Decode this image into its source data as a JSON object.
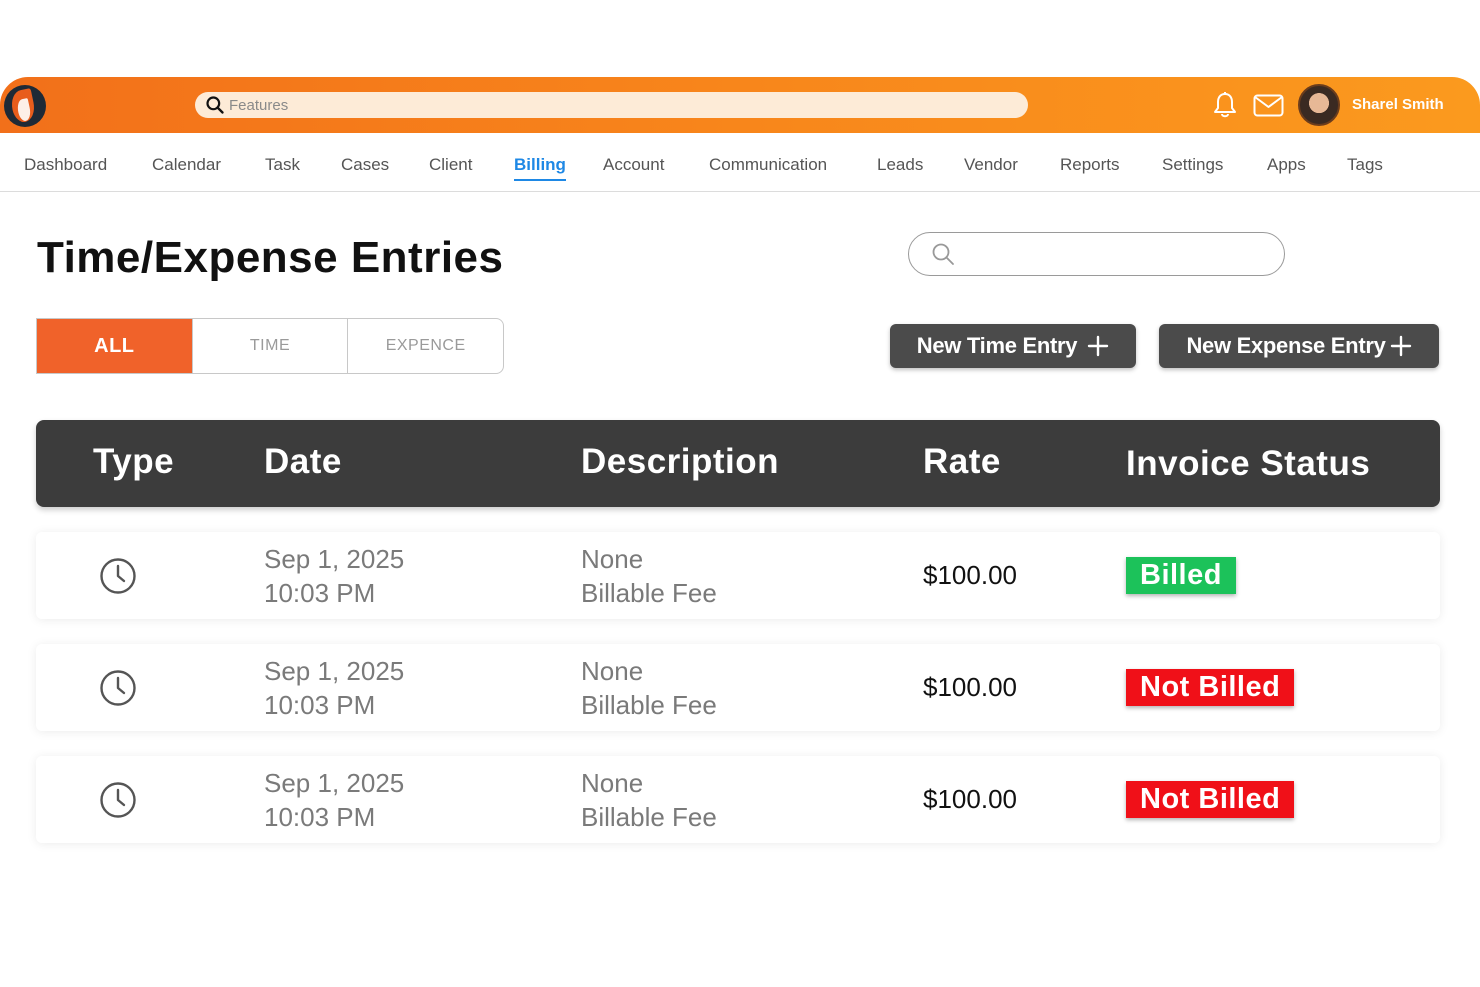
{
  "topbar": {
    "search_placeholder": "Features",
    "username": "Sharel Smith",
    "brand_gradient": [
      "#f2701a",
      "#fb9a1e"
    ]
  },
  "nav": {
    "items": [
      "Dashboard",
      "Calendar",
      "Task",
      "Cases",
      "Client",
      "Billing",
      "Account",
      "Communication",
      "Leads",
      "Vendor",
      "Reports",
      "Settings",
      "Apps",
      "Tags"
    ],
    "active": "Billing",
    "active_color": "#1e88e5"
  },
  "page": {
    "title": "Time/Expense Entries",
    "search_placeholder": ""
  },
  "filters": {
    "tabs": [
      "ALL",
      "TIME",
      "EXPENCE"
    ],
    "active": "ALL",
    "active_color": "#f0622a"
  },
  "actions": {
    "new_time": "New Time Entry",
    "new_expense": "New Expense Entry"
  },
  "table": {
    "headers": [
      "Type",
      "Date",
      "Description",
      "Rate",
      "Invoice Status"
    ],
    "rows": [
      {
        "type_icon": "clock-icon",
        "date": "Sep 1, 2025",
        "time": "10:03 PM",
        "desc_line1": "None",
        "desc_line2": "Billable Fee",
        "rate": "$100.00",
        "status": "Billed",
        "status_color": "#1cc25a"
      },
      {
        "type_icon": "clock-icon",
        "date": "Sep 1, 2025",
        "time": "10:03 PM",
        "desc_line1": "None",
        "desc_line2": "Billable Fee",
        "rate": "$100.00",
        "status": "Not Billed",
        "status_color": "#f01018"
      },
      {
        "type_icon": "clock-icon",
        "date": "Sep 1, 2025",
        "time": "10:03 PM",
        "desc_line1": "None",
        "desc_line2": "Billable Fee",
        "rate": "$100.00",
        "status": "Not Billed",
        "status_color": "#f01018"
      }
    ]
  }
}
